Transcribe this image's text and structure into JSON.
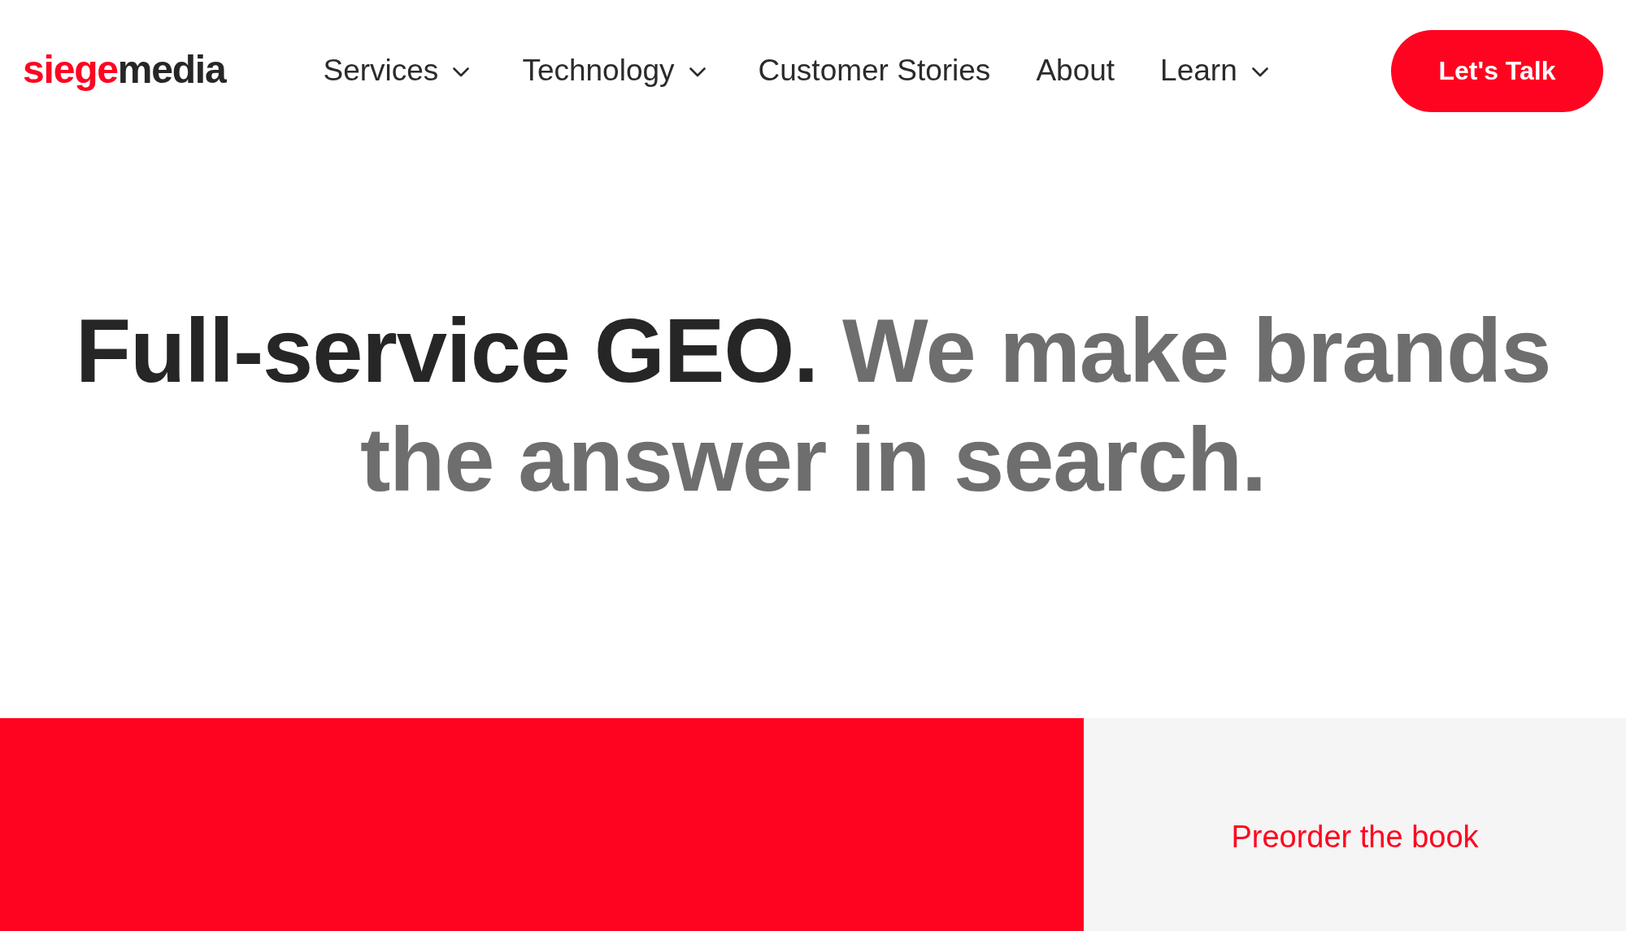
{
  "header": {
    "logo": [
      {
        "text": "siege",
        "accent": true
      },
      {
        "text": "media",
        "accent": false
      }
    ],
    "nav": [
      {
        "label": "Services",
        "has_menu": true
      },
      {
        "label": "Technology",
        "has_menu": true
      },
      {
        "label": "Customer Stories",
        "has_menu": false
      },
      {
        "label": "About",
        "has_menu": false
      },
      {
        "label": "Learn",
        "has_menu": true
      }
    ],
    "cta": "Let's Talk"
  },
  "hero": {
    "headline": [
      {
        "text": "Full-service GEO.",
        "emphasized": true
      },
      {
        "text": "We make brands the answer in search.",
        "emphasized": false
      }
    ]
  },
  "promo": {
    "link": "Preorder the book"
  }
}
